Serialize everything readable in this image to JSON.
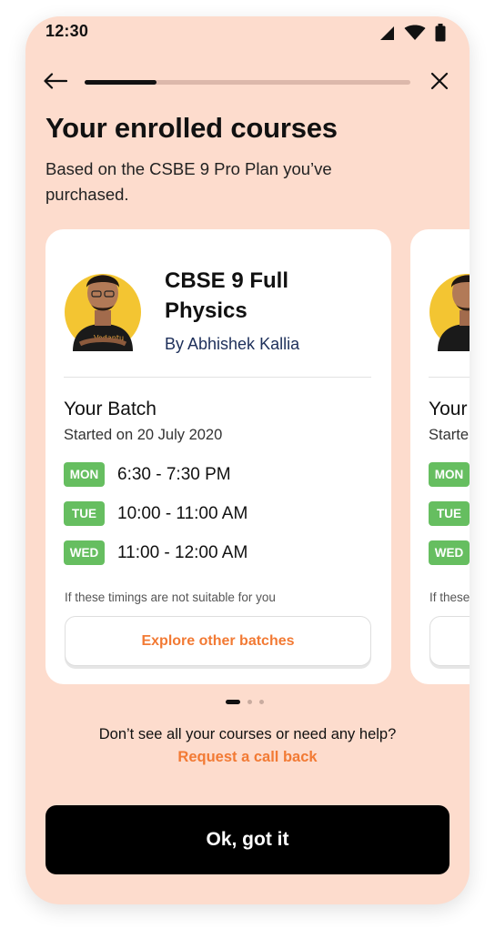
{
  "status_bar": {
    "time": "12:30"
  },
  "onboarding": {
    "progress": 0.22
  },
  "header": {
    "title": "Your enrolled courses",
    "subtitle": "Based on the CSBE 9 Pro Plan you’ve purchased."
  },
  "courses": [
    {
      "title": "CBSE 9 Full Physics",
      "author": "By Abhishek Kallia",
      "batch_heading": "Your Batch",
      "batch_start": "Started on 20 July 2020",
      "slots": [
        {
          "day": "MON",
          "time": "6:30 - 7:30 PM"
        },
        {
          "day": "TUE",
          "time": "10:00 - 11:00 AM"
        },
        {
          "day": "WED",
          "time": "11:00 - 12:00 AM"
        }
      ],
      "timing_note": "If these timings are not suitable for you",
      "explore_label": "Explore other batches"
    },
    {
      "batch_heading": "Your",
      "batch_start": "Starte",
      "slots": [
        {
          "day": "MON"
        },
        {
          "day": "TUE"
        },
        {
          "day": "WED"
        }
      ],
      "timing_note": "If these"
    }
  ],
  "carousel": {
    "pages": 3,
    "active_page": 1
  },
  "help": {
    "question": "Don’t see all your courses or need any help?",
    "callback_label": "Request a call back"
  },
  "primary_button": {
    "label": "Ok, got it"
  },
  "colors": {
    "background": "#fddccd",
    "accent_orange": "#f27a34",
    "day_badge_green": "#66be60",
    "primary_button": "#000000"
  },
  "icons": {
    "back": "arrow-left-icon",
    "close": "close-icon",
    "signal": "cellular-signal-icon",
    "wifi": "wifi-icon",
    "battery": "battery-icon"
  }
}
